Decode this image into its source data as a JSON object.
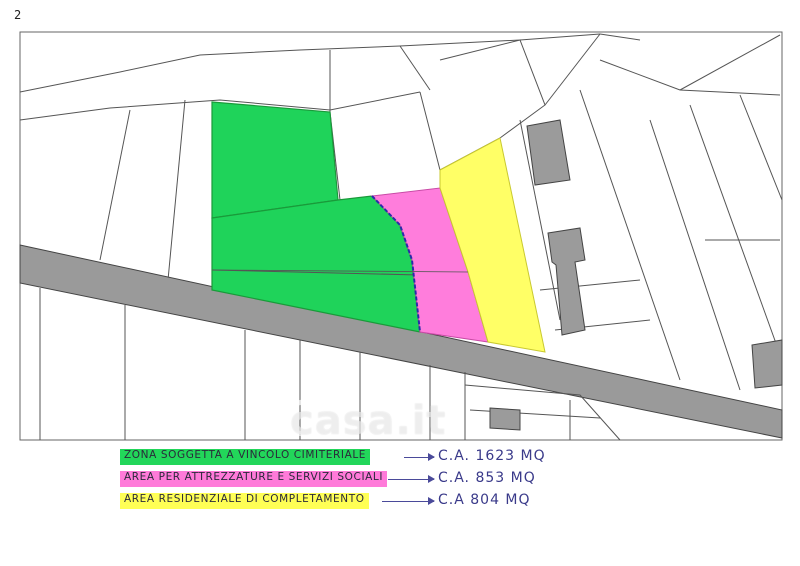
{
  "header": {
    "fragment": "2"
  },
  "legend": [
    {
      "label": "ZONA SOGGETTA A VINCOLO CIMITERIALE",
      "value": "C.A. 1623 MQ",
      "color": "#22d65a"
    },
    {
      "label": "AREA PER ATTREZZATURE E SERVIZI SOCIALI",
      "value": "C.A. 853 MQ",
      "color": "#ff7ad9"
    },
    {
      "label": "AREA RESIDENZIALE DI COMPLETAMENTO",
      "value": "C.A 804 MQ",
      "color": "#ffff55"
    }
  ],
  "watermark": {
    "text": "casa.it",
    "logo": "casa-it-logo"
  },
  "colors": {
    "green_zone": "#1fd35a",
    "pink_zone": "#ff7ddc",
    "yellow_zone": "#ffff66",
    "road": "#9a9a9a",
    "building": "#9b9b9b",
    "parcel_line": "#555555"
  }
}
